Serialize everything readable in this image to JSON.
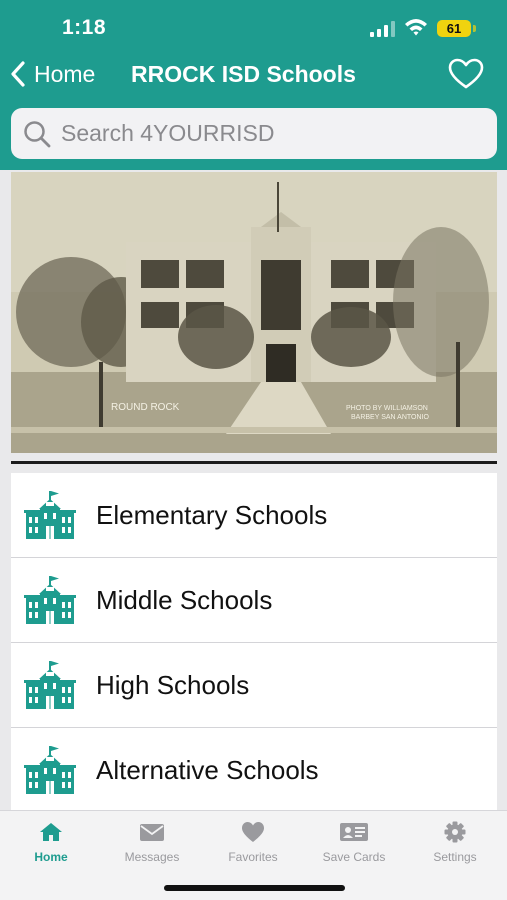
{
  "status_bar": {
    "time": "1:18",
    "battery": "61"
  },
  "nav": {
    "back_label": "Home",
    "title": "RROCK ISD Schools"
  },
  "search": {
    "placeholder": "Search 4YOURRISD"
  },
  "photo": {
    "caption_left": "ROUND ROCK",
    "caption_right": "PHOTO BY WILLIAMSON",
    "caption_right_2": "BARBEY SAN ANTONIO"
  },
  "schools": [
    {
      "label": "Elementary Schools",
      "icon": "school-icon"
    },
    {
      "label": "Middle Schools",
      "icon": "school-icon"
    },
    {
      "label": "High Schools",
      "icon": "school-icon"
    },
    {
      "label": "Alternative Schools",
      "icon": "school-icon"
    }
  ],
  "tabs": [
    {
      "label": "Home",
      "icon": "home-icon",
      "active": true
    },
    {
      "label": "Messages",
      "icon": "envelope-icon",
      "active": false
    },
    {
      "label": "Favorites",
      "icon": "heart-icon",
      "active": false
    },
    {
      "label": "Save Cards",
      "icon": "id-card-icon",
      "active": false
    },
    {
      "label": "Settings",
      "icon": "gear-icon",
      "active": false
    }
  ],
  "colors": {
    "primary": "#1e9c8f",
    "battery": "#f0d30f",
    "inactive": "#9a9a9e"
  }
}
